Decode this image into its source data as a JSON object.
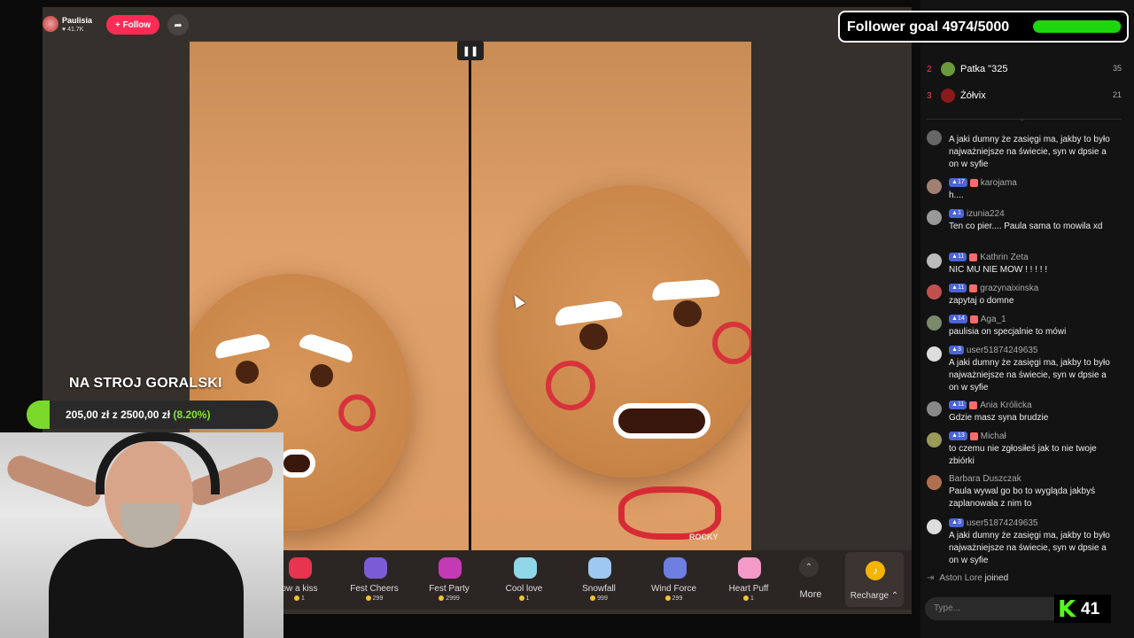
{
  "streamer": {
    "name": "Paulisia",
    "likes": "41.7K",
    "follow_label": "+ Follow"
  },
  "follower_goal": {
    "label": "Follower goal 4974/5000",
    "current": 4974,
    "target": 5000
  },
  "donation_goal": {
    "title": "NA STROJ GORALSKI",
    "current": "205,00 zł",
    "separator": "z",
    "target": "2500,00 zł",
    "percent_text": "(8.20%)",
    "percent": 0.082
  },
  "watermark": "ROCKY",
  "gifts": [
    {
      "label": "ow a kiss",
      "cost": "1",
      "color": "#e8344e"
    },
    {
      "label": "Fest Cheers",
      "cost": "299",
      "color": "#7c5cd6"
    },
    {
      "label": "Fest Party",
      "cost": "2999",
      "color": "#c43ab4"
    },
    {
      "label": "Cool love",
      "cost": "1",
      "color": "#8fd7e8"
    },
    {
      "label": "Snowfall",
      "cost": "999",
      "color": "#9ec8ef"
    },
    {
      "label": "Wind Force",
      "cost": "299",
      "color": "#6d7fe0"
    },
    {
      "label": "Heart Puff",
      "cost": "1",
      "color": "#f49ac8"
    }
  ],
  "more_label": "More",
  "recharge_label": "Recharge",
  "ranking": [
    {
      "rank": "2",
      "name": "Patka \"325",
      "score": "35",
      "avatar": "#6a9a3a"
    },
    {
      "rank": "3",
      "name": "Żółvix",
      "score": "21",
      "avatar": "#8b1a1a"
    }
  ],
  "chat": [
    {
      "user": "",
      "badge": "",
      "text": "A jaki dumny że zasięgi ma, jakby to było najważniejsze na świecie, syn w dpsie a on w syfie",
      "avatar": "#666"
    },
    {
      "user": "karojama",
      "badge": "17",
      "text": "h....",
      "avatar": "#a08070"
    },
    {
      "user": "izunia224",
      "badge": "1",
      "text": "Ten co pier.... Paula sama to mowila xd",
      "avatar": "#999"
    },
    {
      "user": "Kathrin Zeta",
      "badge": "11",
      "text": "NIC MU NIE MOW ! ! ! ! !",
      "avatar": "#bbb"
    },
    {
      "user": "grazynaixinska",
      "badge": "11",
      "text": "zapytaj o domne",
      "avatar": "#c05050"
    },
    {
      "user": "Aga_1",
      "badge": "14",
      "text": "paulisia on specjalnie to mówi",
      "avatar": "#7a8a6a"
    },
    {
      "user": "user51874249635",
      "badge": "3",
      "text": "A jaki dumny że zasięgi ma, jakby to było najważniejsze na świecie, syn w dpsie a on w syfie",
      "avatar": "#ddd"
    },
    {
      "user": "Ania Królicka",
      "badge": "11",
      "text": "Gdzie masz syna brudzie",
      "avatar": "#888"
    },
    {
      "user": "Michał",
      "badge": "13",
      "text": "to czemu nie zgłosiłeś jak to nie twoje zbiórki",
      "avatar": "#9a9a5a"
    },
    {
      "user": "Barbara Duszczak",
      "badge": "",
      "text": "Paula wywal go bo to wygląda jakbyś zaplanowała z nim to",
      "avatar": "#b07050"
    },
    {
      "user": "user51874249635",
      "badge": "3",
      "text": "A jaki dumny że zasięgi ma, jakby to było najważniejsze na świecie, syn w dpsie a on w syfie",
      "avatar": "#ddd"
    }
  ],
  "joined": {
    "user": "Aston Lore",
    "text": "joined"
  },
  "type_placeholder": "Type...",
  "kick": {
    "logo": "K",
    "count": "41"
  }
}
